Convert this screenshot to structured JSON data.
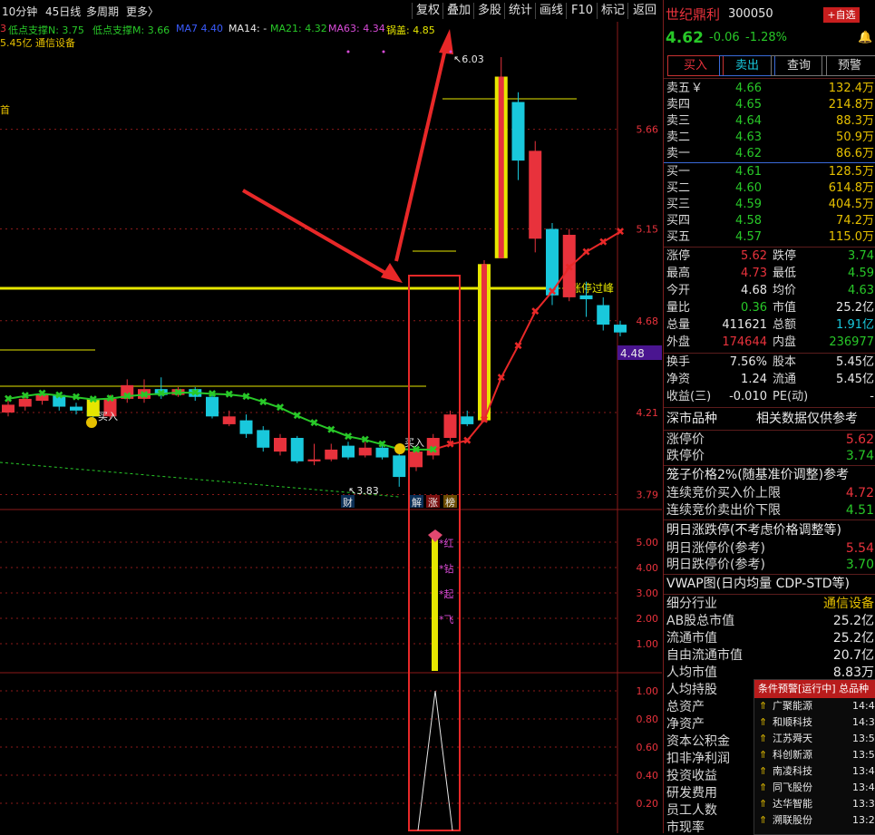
{
  "toolbar": {
    "period": "10分钟",
    "ma_line": "45日线",
    "multi_period": "多周期",
    "more": "更多",
    "more_arrow": "〉",
    "buttons": [
      "复权",
      "叠加",
      "多股",
      "统计",
      "画线",
      "F10",
      "标记",
      "返回"
    ]
  },
  "indicators": {
    "prefix": "3",
    "support_n": "低点支撑N: 3.75",
    "support_m": "低点支撑M: 3.66",
    "ma7": "MA7   4.40",
    "ma14": "MA14: -",
    "ma21": "MA21: 4.32",
    "ma63": "MA63: 4.34",
    "lid": "锅盖: 4.85",
    "line2": "5.45亿 通信设备",
    "left_cut": "首"
  },
  "colors": {
    "up": "#e8323c",
    "down": "#19c8dc",
    "ma_green": "#28c828",
    "ma_red": "#e82828",
    "yellow": "#e6e600",
    "grid": "#8b1a1a",
    "magenta": "#d84bd8"
  },
  "chart": {
    "y_ticks": [
      "5.66",
      "5.15",
      "4.68",
      "4.21",
      "3.79"
    ],
    "price_tag": "4.48",
    "high_label": "6.03",
    "low_label": "3.83",
    "limit_label": "涨停过峰",
    "buy_marks": [
      "买入",
      "买入"
    ],
    "tags": [
      "财",
      "解",
      "涨",
      "榜"
    ],
    "sub1_ticks": [
      "5.00",
      "4.00",
      "3.00",
      "2.00",
      "1.00"
    ],
    "sub1_words": [
      "红",
      "钻",
      "起",
      "飞"
    ],
    "sub2_ticks": [
      "1.00",
      "0.80",
      "0.60",
      "0.40",
      "0.20"
    ]
  },
  "candles": [
    {
      "o": 4.21,
      "c": 4.25,
      "h": 4.27,
      "l": 4.19
    },
    {
      "o": 4.24,
      "c": 4.28,
      "h": 4.3,
      "l": 4.22
    },
    {
      "o": 4.27,
      "c": 4.3,
      "h": 4.31,
      "l": 4.25
    },
    {
      "o": 4.3,
      "c": 4.24,
      "h": 4.31,
      "l": 4.22
    },
    {
      "o": 4.24,
      "c": 4.22,
      "h": 4.26,
      "l": 4.2
    },
    {
      "o": 4.22,
      "c": 4.19,
      "h": 4.24,
      "l": 4.17
    },
    {
      "o": 4.19,
      "c": 4.28,
      "h": 4.3,
      "l": 4.18
    },
    {
      "o": 4.28,
      "c": 4.35,
      "h": 4.38,
      "l": 4.26
    },
    {
      "o": 4.28,
      "c": 4.33,
      "h": 4.38,
      "l": 4.26
    },
    {
      "o": 4.33,
      "c": 4.3,
      "h": 4.39,
      "l": 4.28
    },
    {
      "o": 4.3,
      "c": 4.33,
      "h": 4.34,
      "l": 4.29
    },
    {
      "o": 4.33,
      "c": 4.29,
      "h": 4.34,
      "l": 4.27
    },
    {
      "o": 4.29,
      "c": 4.19,
      "h": 4.31,
      "l": 4.18
    },
    {
      "o": 4.15,
      "c": 4.19,
      "h": 4.22,
      "l": 4.14
    },
    {
      "o": 4.17,
      "c": 4.1,
      "h": 4.2,
      "l": 4.08
    },
    {
      "o": 4.12,
      "c": 4.03,
      "h": 4.14,
      "l": 4.01
    },
    {
      "o": 4.01,
      "c": 4.08,
      "h": 4.1,
      "l": 3.99
    },
    {
      "o": 4.08,
      "c": 3.96,
      "h": 4.09,
      "l": 3.95
    },
    {
      "o": 3.96,
      "c": 3.97,
      "h": 4.05,
      "l": 3.94
    },
    {
      "o": 3.97,
      "c": 4.02,
      "h": 4.05,
      "l": 3.96
    },
    {
      "o": 4.04,
      "c": 3.98,
      "h": 4.06,
      "l": 3.97
    },
    {
      "o": 3.99,
      "c": 4.03,
      "h": 4.06,
      "l": 3.98
    },
    {
      "o": 4.03,
      "c": 3.98,
      "h": 4.06,
      "l": 3.97
    },
    {
      "o": 3.99,
      "c": 3.88,
      "h": 4.0,
      "l": 3.83
    },
    {
      "o": 3.93,
      "c": 4.01,
      "h": 4.03,
      "l": 3.91
    },
    {
      "o": 3.99,
      "c": 4.08,
      "h": 4.1,
      "l": 3.97
    },
    {
      "o": 4.08,
      "c": 4.2,
      "h": 4.22,
      "l": 4.05
    },
    {
      "o": 4.19,
      "c": 4.15,
      "h": 4.22,
      "l": 4.14
    },
    {
      "o": 4.17,
      "c": 4.97,
      "h": 4.99,
      "l": 4.16
    },
    {
      "o": 5.0,
      "c": 5.93,
      "h": 6.03,
      "l": 5.86
    },
    {
      "o": 5.8,
      "c": 5.5,
      "h": 5.85,
      "l": 5.4
    },
    {
      "o": 5.1,
      "c": 5.55,
      "h": 5.6,
      "l": 5.03
    },
    {
      "o": 5.15,
      "c": 4.81,
      "h": 5.18,
      "l": 4.76
    },
    {
      "o": 4.8,
      "c": 5.12,
      "h": 5.15,
      "l": 4.78
    },
    {
      "o": 4.81,
      "c": 4.79,
      "h": 4.88,
      "l": 4.7
    },
    {
      "o": 4.76,
      "c": 4.66,
      "h": 4.8,
      "l": 4.63
    },
    {
      "o": 4.66,
      "c": 4.62,
      "h": 4.68,
      "l": 4.6
    }
  ],
  "stock": {
    "name": "世纪鼎利",
    "code": "300050",
    "add_btn": "+自选",
    "price": "4.62",
    "change": "-0.06",
    "pct": "-1.28%",
    "bell": "🔔"
  },
  "actions": [
    "买入",
    "卖出",
    "查询",
    "预警"
  ],
  "asks": [
    {
      "label": "卖五",
      "mark": "￥",
      "price": "4.66",
      "vol": "132.4万"
    },
    {
      "label": "卖四",
      "mark": "",
      "price": "4.65",
      "vol": "214.8万"
    },
    {
      "label": "卖三",
      "mark": "",
      "price": "4.64",
      "vol": "88.3万"
    },
    {
      "label": "卖二",
      "mark": "",
      "price": "4.63",
      "vol": "50.9万"
    },
    {
      "label": "卖一",
      "mark": "",
      "price": "4.62",
      "vol": "86.6万"
    }
  ],
  "bids": [
    {
      "label": "买一",
      "price": "4.61",
      "vol": "128.5万"
    },
    {
      "label": "买二",
      "price": "4.60",
      "vol": "614.8万"
    },
    {
      "label": "买三",
      "price": "4.59",
      "vol": "404.5万"
    },
    {
      "label": "买四",
      "price": "4.58",
      "vol": "74.2万"
    },
    {
      "label": "买五",
      "price": "4.57",
      "vol": "115.0万"
    }
  ],
  "quote": [
    {
      "k1": "涨停",
      "v1": "5.62",
      "k2": "跌停",
      "v2": "3.74",
      "c1": "#e8323c",
      "c2": "#28c828"
    },
    {
      "k1": "最高",
      "v1": "4.73",
      "k2": "最低",
      "v2": "4.59",
      "c1": "#e8323c",
      "c2": "#28c828"
    },
    {
      "k1": "今开",
      "v1": "4.68",
      "k2": "均价",
      "v2": "4.63",
      "c1": "#e8e8e8",
      "c2": "#28c828"
    },
    {
      "k1": "量比",
      "v1": "0.36",
      "k2": "市值",
      "v2": "25.2亿",
      "c1": "#28c828",
      "c2": "#e8e8e8"
    },
    {
      "k1": "总量",
      "v1": "411621",
      "k2": "总额",
      "v2": "1.91亿",
      "c1": "#e8e8e8",
      "c2": "#19c8dc"
    },
    {
      "k1": "外盘",
      "v1": "174644",
      "k2": "内盘",
      "v2": "236977",
      "c1": "#e8323c",
      "c2": "#28c828"
    }
  ],
  "fund": [
    {
      "k1": "换手",
      "v1": "7.56%",
      "k2": "股本",
      "v2": "5.45亿"
    },
    {
      "k1": "净资",
      "v1": "1.24",
      "k2": "流通",
      "v2": "5.45亿"
    },
    {
      "k1": "收益(三)",
      "v1": "-0.010",
      "k2": "PE(动)",
      "v2": "-"
    }
  ],
  "market": {
    "label": "深市品种",
    "note": "相关数据仅供参考"
  },
  "limits": [
    {
      "k": "涨停价",
      "v": "5.62",
      "c": "#e8323c"
    },
    {
      "k": "跌停价",
      "v": "3.74",
      "c": "#28c828"
    }
  ],
  "cage": {
    "title": "笼子价格2%(随基准价调整)参考",
    "rows": [
      {
        "k": "连续竞价买入价上限",
        "v": "4.72",
        "c": "#e8323c"
      },
      {
        "k": "连续竞价卖出价下限",
        "v": "4.51",
        "c": "#28c828"
      }
    ]
  },
  "tomorrow": {
    "title": "明日涨跌停(不考虑价格调整等)",
    "rows": [
      {
        "k": "明日涨停价(参考)",
        "v": "5.54",
        "c": "#e8323c"
      },
      {
        "k": "明日跌停价(参考)",
        "v": "3.70",
        "c": "#28c828"
      }
    ]
  },
  "vwap": "VWAP图(日内均量 CDP-STD等)",
  "details": [
    {
      "k": "细分行业",
      "v": "通信设备",
      "c": "#e6c000"
    },
    {
      "k": "AB股总市值",
      "v": "25.2亿",
      "c": "#e8e8e8"
    },
    {
      "k": "流通市值",
      "v": "25.2亿",
      "c": "#e8e8e8"
    },
    {
      "k": "自由流通市值",
      "v": "20.7亿",
      "c": "#e8e8e8"
    },
    {
      "k": "人均市值",
      "v": "8.83万",
      "c": "#e8e8e8"
    },
    {
      "k": "人均持股",
      "v": "",
      "c": "#e8e8e8"
    },
    {
      "k": "总资产",
      "v": "",
      "c": "#e8e8e8"
    },
    {
      "k": "净资产",
      "v": "",
      "c": "#e8e8e8"
    },
    {
      "k": "资本公积金",
      "v": "",
      "c": "#e8e8e8"
    },
    {
      "k": "扣非净利润",
      "v": "",
      "c": "#e8e8e8"
    },
    {
      "k": "投资收益",
      "v": "",
      "c": "#e8e8e8"
    },
    {
      "k": "研发费用",
      "v": "",
      "c": "#e8e8e8"
    },
    {
      "k": "员工人数",
      "v": "",
      "c": "#e8e8e8"
    },
    {
      "k": "市现率",
      "v": "",
      "c": "#e8e8e8"
    }
  ],
  "alert": {
    "header": "条件预警[运行中] 总品种",
    "items": [
      {
        "name": "广聚能源",
        "time": "14:4"
      },
      {
        "name": "和顺科技",
        "time": "14:3"
      },
      {
        "name": "江苏舜天",
        "time": "13:5"
      },
      {
        "name": "科创新源",
        "time": "13:5"
      },
      {
        "name": "南凌科技",
        "time": "13:4"
      },
      {
        "name": "同飞股份",
        "time": "13:4"
      },
      {
        "name": "达华智能",
        "time": "13:3"
      },
      {
        "name": "溯联股份",
        "time": "13:2"
      }
    ]
  }
}
